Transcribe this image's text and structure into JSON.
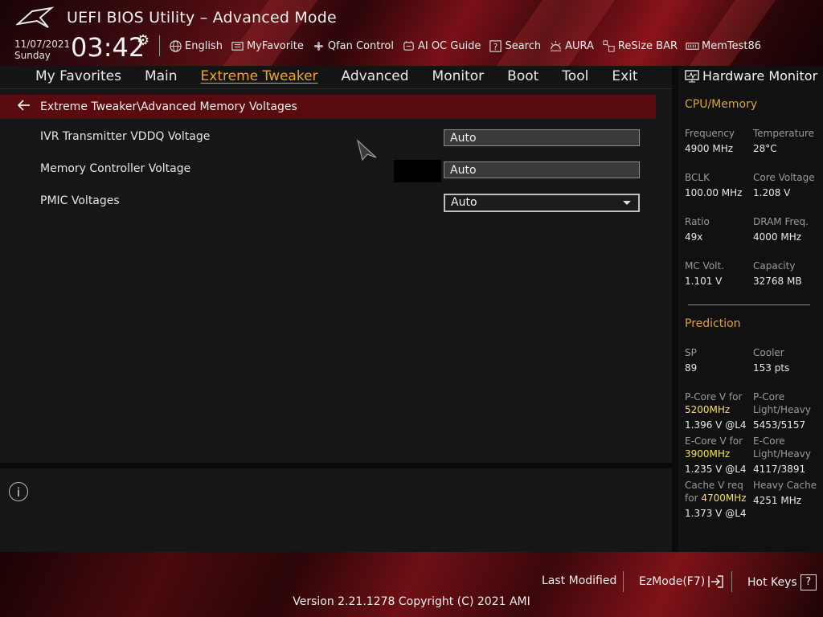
{
  "header": {
    "title": "UEFI BIOS Utility – Advanced Mode",
    "date": "11/07/2021",
    "day": "Sunday",
    "time": "03:42",
    "toolbar": [
      {
        "label": "English",
        "icon": "globe-icon"
      },
      {
        "label": "MyFavorite",
        "icon": "favorite-icon"
      },
      {
        "label": "Qfan Control",
        "icon": "fan-icon"
      },
      {
        "label": "AI OC Guide",
        "icon": "oc-guide-icon"
      },
      {
        "label": "Search",
        "icon": "search-icon"
      },
      {
        "label": "AURA",
        "icon": "aura-icon"
      },
      {
        "label": "ReSize BAR",
        "icon": "resize-bar-icon"
      },
      {
        "label": "MemTest86",
        "icon": "memtest-icon"
      }
    ]
  },
  "nav": {
    "tabs": [
      "My Favorites",
      "Main",
      "Extreme Tweaker",
      "Advanced",
      "Monitor",
      "Boot",
      "Tool",
      "Exit"
    ],
    "active": "Extreme Tweaker"
  },
  "breadcrumb": "Extreme Tweaker\\Advanced Memory Voltages",
  "settings": [
    {
      "label": "IVR Transmitter VDDQ Voltage",
      "value": "Auto"
    },
    {
      "label": "Memory Controller Voltage",
      "value": "Auto"
    },
    {
      "label": "PMIC Voltages",
      "value": "Auto"
    }
  ],
  "hardware_monitor": {
    "title": "Hardware Monitor",
    "cpu_memory": {
      "heading": "CPU/Memory",
      "frequency_label": "Frequency",
      "frequency": "4900 MHz",
      "temperature_label": "Temperature",
      "temperature": "28°C",
      "bclk_label": "BCLK",
      "bclk": "100.00 MHz",
      "core_voltage_label": "Core Voltage",
      "core_voltage": "1.208 V",
      "ratio_label": "Ratio",
      "ratio": "49x",
      "dram_freq_label": "DRAM Freq.",
      "dram_freq": "4000 MHz",
      "mc_volt_label": "MC Volt.",
      "mc_volt": "1.101 V",
      "capacity_label": "Capacity",
      "capacity": "32768 MB"
    },
    "prediction": {
      "heading": "Prediction",
      "sp_label": "SP",
      "sp": "89",
      "cooler_label": "Cooler",
      "cooler": "153 pts",
      "pcore_v_label": "P-Core V for",
      "pcore_v_freq": "5200MHz",
      "pcore_v": "1.396 V @L4",
      "pcore_lh_label1": "P-Core",
      "pcore_lh_label2": "Light/Heavy",
      "pcore_lh": "5453/5157",
      "ecore_v_label": "E-Core V for",
      "ecore_v_freq": "3900MHz",
      "ecore_v": "1.235 V @L4",
      "ecore_lh_label1": "E-Core",
      "ecore_lh_label2": "Light/Heavy",
      "ecore_lh": "4117/3891",
      "cache_v_label1": "Cache V req",
      "cache_v_label2": "for",
      "cache_v_freq": "4700MHz",
      "cache_v": "1.373 V @L4",
      "heavy_cache_label": "Heavy Cache",
      "heavy_cache": "4251 MHz"
    }
  },
  "footer": {
    "last_modified": "Last Modified",
    "ezmode": "EzMode(F7)",
    "hot_keys": "Hot Keys",
    "hot_keys_glyph": "?",
    "version": "Version 2.21.1278 Copyright (C) 2021 AMI"
  },
  "colors": {
    "accent": "#f0a52a",
    "breadcrumb_bg": "#5a0b0f",
    "highlight": "#f5e05a"
  }
}
